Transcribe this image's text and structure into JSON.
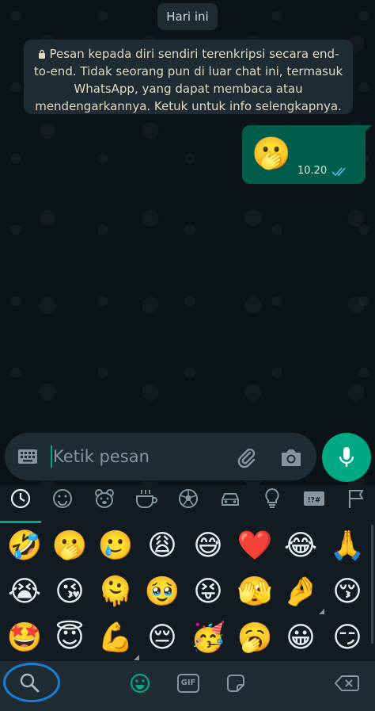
{
  "chat": {
    "date_chip": "Hari ini",
    "e2e_notice": "Pesan kepada diri sendiri terenkripsi secara end-to-end. Tidak seorang pun di luar chat ini, termasuk WhatsApp, yang dapat membaca atau mendengarkannya. Ketuk untuk info selengkapnya.",
    "message": {
      "emoji": "🫢",
      "time": "10.20",
      "status": "read"
    }
  },
  "input": {
    "placeholder": "Ketik pesan",
    "icons": [
      "keyboard-icon",
      "attach-icon",
      "camera-icon",
      "mic-icon"
    ]
  },
  "emoji_panel": {
    "categories": [
      "recent",
      "smileys",
      "animals",
      "food",
      "activities",
      "travel",
      "objects",
      "symbols",
      "flags"
    ],
    "selected_category": "recent",
    "rows": [
      [
        "🤣",
        "🫢",
        "🥲",
        "😩",
        "😅",
        "❤️",
        "😂",
        "🙏"
      ],
      [
        "😭",
        "😘",
        "🫠",
        "🥹",
        "😝",
        "🫣",
        "🤌",
        "😚"
      ],
      [
        "🤩",
        "😇",
        "💪",
        "😔",
        "🥳",
        "🥱",
        "😀",
        "😏"
      ]
    ],
    "bottom_tabs": [
      "search",
      "emoji",
      "GIF",
      "sticker",
      "backspace"
    ],
    "gif_label": "GIF"
  },
  "colors": {
    "accent": "#00a884",
    "outgoing_bubble": "#005c4b",
    "panel": "#121b22",
    "highlight_ring": "#1a7fd4"
  }
}
